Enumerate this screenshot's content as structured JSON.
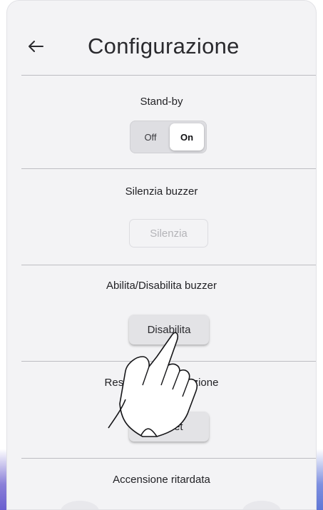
{
  "header": {
    "title": "Configurazione",
    "back_icon": "arrow-left-icon"
  },
  "sections": {
    "standby": {
      "label": "Stand-by",
      "toggle_off": "Off",
      "toggle_on": "On",
      "selected": "On"
    },
    "silence_buzzer": {
      "label": "Silenzia buzzer",
      "button": "Silenzia",
      "button_enabled": false
    },
    "toggle_buzzer": {
      "label": "Abilita/Disabilita buzzer",
      "button": "Disabilita"
    },
    "reset_notification": {
      "label_start": "Res",
      "label_end": "ficazione",
      "button": "Reset"
    },
    "delayed_power": {
      "label": "Accensione ritardata"
    }
  },
  "colors": {
    "screen_background": "#f3f3f5",
    "divider": "#bdbdc2",
    "button": "#e3e3e6",
    "accent_bottom": "#6b5fcf"
  },
  "overlay": {
    "icon": "touch-hand-icon"
  }
}
